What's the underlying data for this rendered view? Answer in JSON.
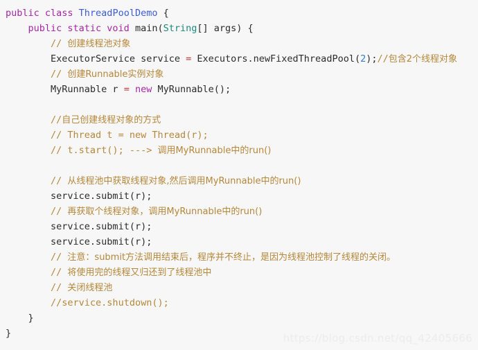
{
  "editor": {
    "language": "java",
    "background_color": "#f7f7f7",
    "default_text_color": "#2b2b2b",
    "colors": {
      "keyword": "#a626a4",
      "class_name": "#3b5bdb",
      "builtin_type": "#1a8a7a",
      "operator": "#d03030",
      "number": "#2b7fd0",
      "comment": "#b5873a",
      "watermark": "#ececec"
    }
  },
  "watermark": {
    "text": "https://blog.csdn.net/qq_42405666"
  },
  "code": {
    "lines": [
      {
        "index": 0,
        "indent": 0,
        "tokens": [
          {
            "t": "public class ",
            "c": "kw"
          },
          {
            "t": "ThreadPoolDemo",
            "c": "type"
          },
          {
            "t": " {",
            "c": "plain"
          }
        ]
      },
      {
        "index": 1,
        "indent": 1,
        "tokens": [
          {
            "t": "public static void ",
            "c": "kw"
          },
          {
            "t": "main(",
            "c": "plain"
          },
          {
            "t": "String",
            "c": "type2"
          },
          {
            "t": "[] args) {",
            "c": "plain"
          }
        ]
      },
      {
        "index": 2,
        "indent": 2,
        "tokens": [
          {
            "t": "// ",
            "c": "comment"
          },
          {
            "t": "创建线程池对象",
            "c": "comment",
            "cjk": true
          }
        ]
      },
      {
        "index": 3,
        "indent": 2,
        "tokens": [
          {
            "t": "ExecutorService service ",
            "c": "plain"
          },
          {
            "t": "=",
            "c": "op"
          },
          {
            "t": " Executors.newFixedThreadPool(",
            "c": "plain"
          },
          {
            "t": "2",
            "c": "num"
          },
          {
            "t": ");",
            "c": "plain"
          },
          {
            "t": "//",
            "c": "comment"
          },
          {
            "t": "包含2个线程对象",
            "c": "comment",
            "cjk": true
          }
        ]
      },
      {
        "index": 4,
        "indent": 2,
        "tokens": [
          {
            "t": "// ",
            "c": "comment"
          },
          {
            "t": "创建Runnable实例对象",
            "c": "comment",
            "cjk": true
          }
        ]
      },
      {
        "index": 5,
        "indent": 2,
        "tokens": [
          {
            "t": "MyRunnable r ",
            "c": "plain"
          },
          {
            "t": "=",
            "c": "op"
          },
          {
            "t": " ",
            "c": "plain"
          },
          {
            "t": "new",
            "c": "kw"
          },
          {
            "t": " MyRunnable();",
            "c": "plain"
          }
        ]
      },
      {
        "index": 6,
        "indent": 0,
        "blank": true,
        "tokens": []
      },
      {
        "index": 7,
        "indent": 2,
        "tokens": [
          {
            "t": "//",
            "c": "comment"
          },
          {
            "t": "自己创建线程对象的方式",
            "c": "comment",
            "cjk": true
          }
        ]
      },
      {
        "index": 8,
        "indent": 2,
        "tokens": [
          {
            "t": "// Thread t = new Thread(r);",
            "c": "comment"
          }
        ]
      },
      {
        "index": 9,
        "indent": 2,
        "tokens": [
          {
            "t": "// t.start(); ---> ",
            "c": "comment"
          },
          {
            "t": "调用MyRunnable中的run()",
            "c": "comment",
            "cjk": true
          }
        ]
      },
      {
        "index": 10,
        "indent": 0,
        "blank": true,
        "tokens": []
      },
      {
        "index": 11,
        "indent": 2,
        "tokens": [
          {
            "t": "// ",
            "c": "comment"
          },
          {
            "t": "从线程池中获取线程对象,然后调用MyRunnable中的run()",
            "c": "comment",
            "cjk": true
          }
        ]
      },
      {
        "index": 12,
        "indent": 2,
        "tokens": [
          {
            "t": "service.submit(r);",
            "c": "plain"
          }
        ]
      },
      {
        "index": 13,
        "indent": 2,
        "tokens": [
          {
            "t": "// ",
            "c": "comment"
          },
          {
            "t": "再获取个线程对象，调用MyRunnable中的run()",
            "c": "comment",
            "cjk": true
          }
        ]
      },
      {
        "index": 14,
        "indent": 2,
        "tokens": [
          {
            "t": "service.submit(r);",
            "c": "plain"
          }
        ]
      },
      {
        "index": 15,
        "indent": 2,
        "tokens": [
          {
            "t": "service.submit(r);",
            "c": "plain"
          }
        ]
      },
      {
        "index": 16,
        "indent": 2,
        "tokens": [
          {
            "t": "// ",
            "c": "comment"
          },
          {
            "t": "注意：submit方法调用结束后，程序并不终止，是因为线程池控制了线程的关闭。",
            "c": "comment",
            "cjk": true
          }
        ]
      },
      {
        "index": 17,
        "indent": 2,
        "tokens": [
          {
            "t": "// ",
            "c": "comment"
          },
          {
            "t": "将使用完的线程又归还到了线程池中",
            "c": "comment",
            "cjk": true
          }
        ]
      },
      {
        "index": 18,
        "indent": 2,
        "tokens": [
          {
            "t": "// ",
            "c": "comment"
          },
          {
            "t": "关闭线程池",
            "c": "comment",
            "cjk": true
          }
        ]
      },
      {
        "index": 19,
        "indent": 2,
        "tokens": [
          {
            "t": "//service.shutdown();",
            "c": "comment"
          }
        ]
      },
      {
        "index": 20,
        "indent": 1,
        "tokens": [
          {
            "t": "}",
            "c": "plain"
          }
        ]
      },
      {
        "index": 21,
        "indent": 0,
        "tokens": [
          {
            "t": "}",
            "c": "plain"
          }
        ]
      }
    ]
  }
}
